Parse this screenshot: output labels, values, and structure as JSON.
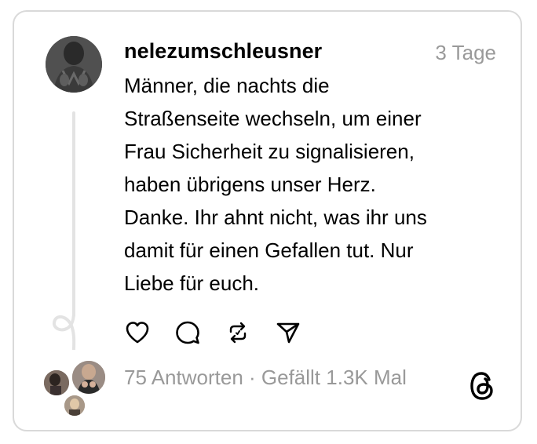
{
  "post": {
    "username": "nelezumschleusner",
    "time": "3 Tage",
    "text": "Männer, die nachts die\nStraßenseite wechseln, um einer\nFrau Sicherheit zu signalisieren,\nhaben übrigens unser Herz.\nDanke. Ihr ahnt nicht, was ihr uns\ndamit für einen Gefallen tut. Nur\nLiebe für euch."
  },
  "actions": {
    "icons": [
      "heart-icon",
      "comment-icon",
      "repost-icon",
      "share-icon"
    ]
  },
  "stats": {
    "replies": "75 Antworten",
    "separator": " · ",
    "likes": "Gefällt 1.3K Mal"
  },
  "colors": {
    "text": "#000000",
    "muted": "#999999",
    "border": "#d9d9d9",
    "thread_line": "#e3e3e3"
  }
}
